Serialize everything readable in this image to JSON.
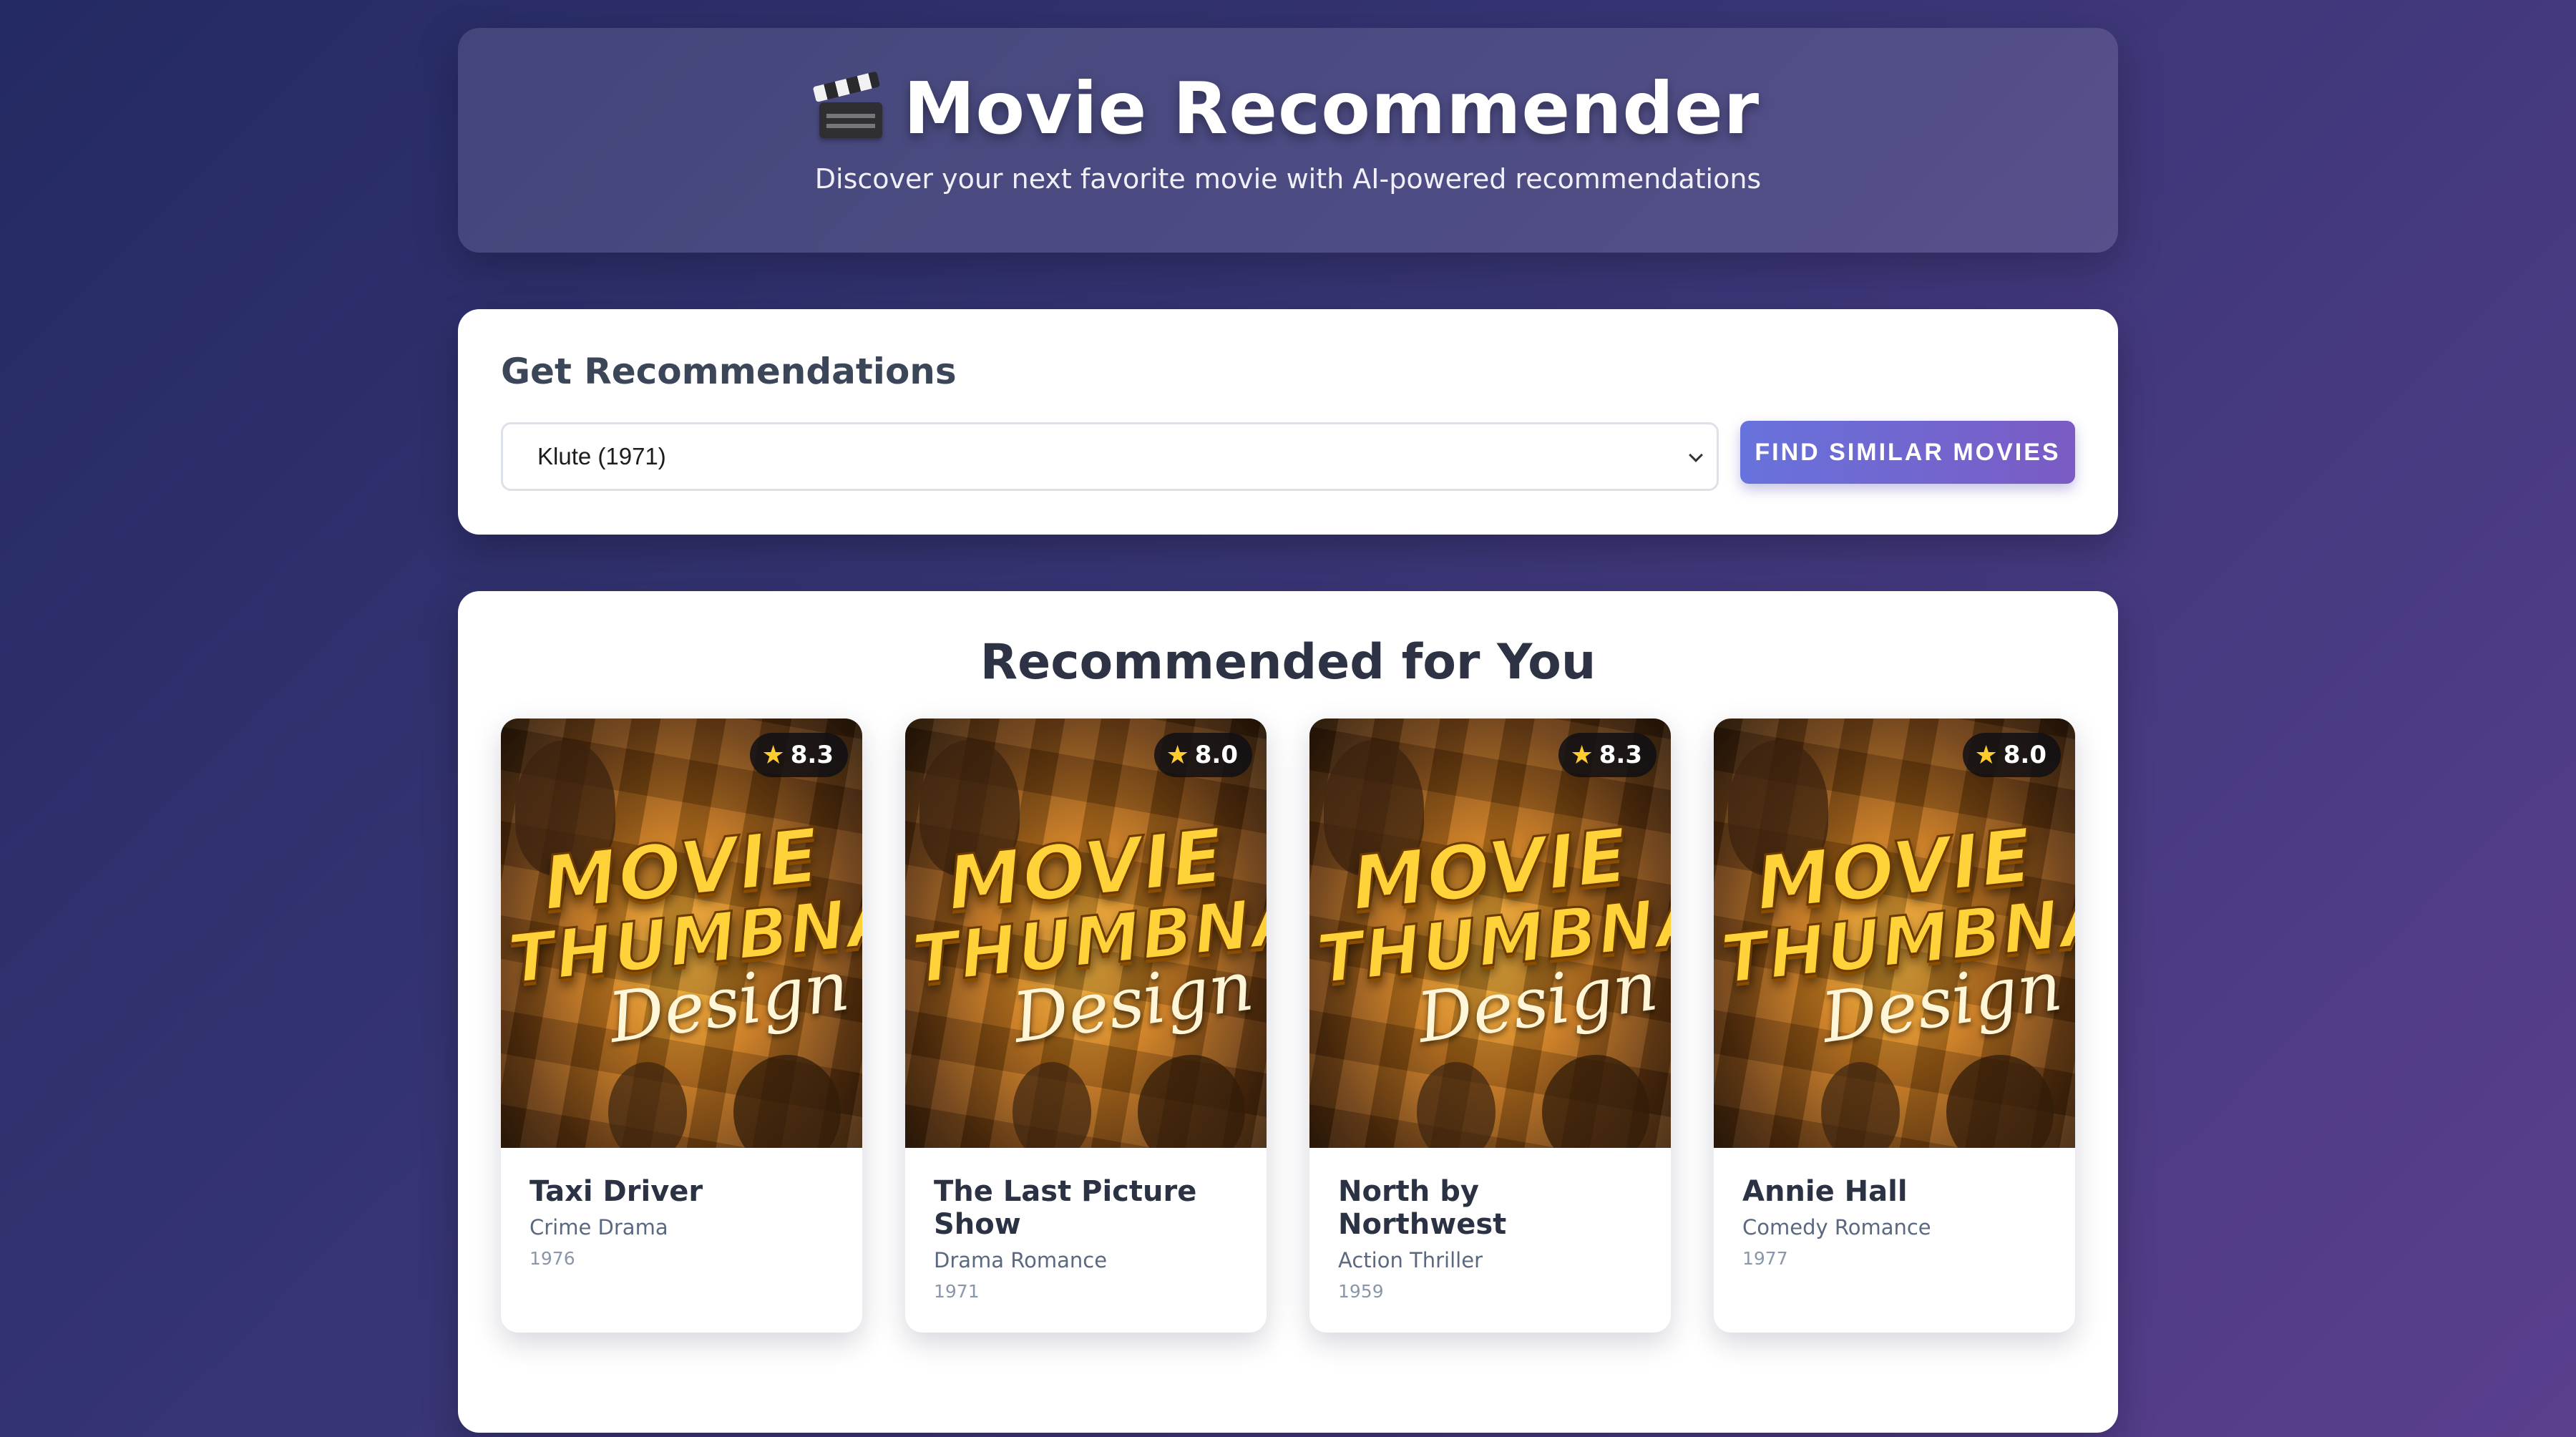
{
  "header": {
    "icon": "clapperboard-icon",
    "title": "Movie Recommender",
    "subtitle": "Discover your next favorite movie with AI-powered recommendations"
  },
  "search": {
    "heading": "Get Recommendations",
    "selected_movie": "Klute (1971)",
    "button_label": "Find Similar Movies"
  },
  "results": {
    "heading": "Recommended for You",
    "poster_text": {
      "line1": "MOVIE",
      "line2": "THUMBNAIL",
      "line3": "Design"
    },
    "movies": [
      {
        "title": "Taxi Driver",
        "genre": "Crime Drama",
        "year": "1976",
        "rating": "8.3"
      },
      {
        "title": "The Last Picture Show",
        "genre": "Drama Romance",
        "year": "1971",
        "rating": "8.0"
      },
      {
        "title": "North by Northwest",
        "genre": "Action Thriller",
        "year": "1959",
        "rating": "8.3"
      },
      {
        "title": "Annie Hall",
        "genre": "Comedy Romance",
        "year": "1977",
        "rating": "8.0"
      }
    ]
  },
  "colors": {
    "background_start": "#242a63",
    "background_end": "#5a3f8f",
    "button_start": "#6872dc",
    "button_end": "#7b5bc4",
    "star": "#ffcc2e"
  }
}
